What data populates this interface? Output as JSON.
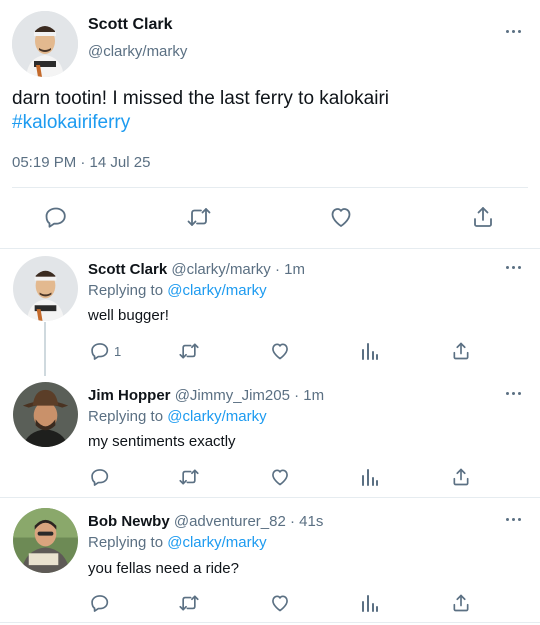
{
  "tweet": {
    "author_name": "Scott Clark",
    "author_handle": "@clarky/marky",
    "text": "darn tootin! I missed the last ferry to kalokairi",
    "hashtag": "#kalokairiferry",
    "timestamp": "05:19 PM · 14 Jul 25",
    "actions": [
      "reply-icon",
      "retweet-icon",
      "like-icon",
      "share-icon"
    ]
  },
  "replies": [
    {
      "author_name": "Scott Clark",
      "author_handle": "@clarky/marky",
      "time": "· 1m",
      "replying_prefix": "Replying to",
      "replying_to": "@clarky/marky",
      "text": "well bugger!",
      "reply_count": "1"
    },
    {
      "author_name": "Jim Hopper",
      "author_handle": "@Jimmy_Jim205",
      "time": "· 1m",
      "replying_prefix": "Replying to",
      "replying_to": "@clarky/marky",
      "text": "my sentiments exactly",
      "reply_count": ""
    },
    {
      "author_name": "Bob Newby",
      "author_handle": "@adventurer_82",
      "time": "· 41s",
      "replying_prefix": "Replying to",
      "replying_to": "@clarky/marky",
      "text": "you fellas need a ride?",
      "reply_count": ""
    }
  ],
  "colors": {
    "accent": "#1d9bf0",
    "muted": "#5b7083",
    "divider": "#e6ecf0",
    "text": "#0f1419"
  }
}
